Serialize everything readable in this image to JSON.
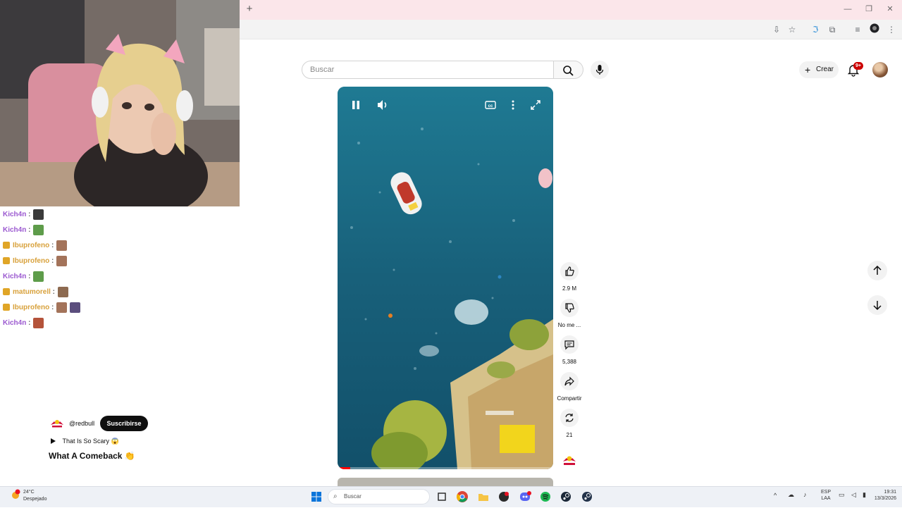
{
  "youtube": {
    "search_placeholder": "Buscar",
    "create_label": "Crear",
    "notification_badge": "9+"
  },
  "chat": [
    {
      "user": "Kich4n",
      "color": "purple",
      "emotes": [
        "#3b3b3b"
      ]
    },
    {
      "user": "Kich4n",
      "color": "purple",
      "emotes": [
        "#5e9c4a"
      ]
    },
    {
      "user": "Ibuprofeno",
      "color": "orange",
      "badge": true,
      "emotes": [
        "#a3735a"
      ]
    },
    {
      "user": "Ibuprofeno",
      "color": "orange",
      "badge": true,
      "emotes": [
        "#a3735a"
      ]
    },
    {
      "user": "Kich4n",
      "color": "purple",
      "emotes": [
        "#5e9c4a"
      ]
    },
    {
      "user": "matumorell",
      "color": "orange",
      "badge": true,
      "emotes": [
        "#8d6a50"
      ]
    },
    {
      "user": "Ibuprofeno",
      "color": "orange",
      "badge": true,
      "emotes": [
        "#a3735a",
        "#5b4e7d"
      ]
    },
    {
      "user": "Kich4n",
      "color": "purple",
      "emotes": [
        "#b4533a"
      ]
    }
  ],
  "short": {
    "channel": "@redbull",
    "subscribe_label": "Suscribirse",
    "sound": "That Is So Scary 😱",
    "title": "What A Comeback 👏",
    "progress": 0.06
  },
  "actions": {
    "likes": "2.9 M",
    "dislike_label": "No me ...",
    "comments": "5,388",
    "share_label": "Compartir",
    "remix_count": "21"
  },
  "taskbar": {
    "weather_temp": "24°C",
    "weather_desc": "Despejado",
    "search_label": "Buscar",
    "lang_top": "ESP",
    "lang_bottom": "LAA",
    "time": "19:31",
    "date": "13/3/2026"
  },
  "colors": {
    "youtube_red": "#ff0000",
    "subscribe_bg": "#0f0f0f",
    "water": "#1f6b82",
    "tab_strip": "#fbe6ea"
  }
}
